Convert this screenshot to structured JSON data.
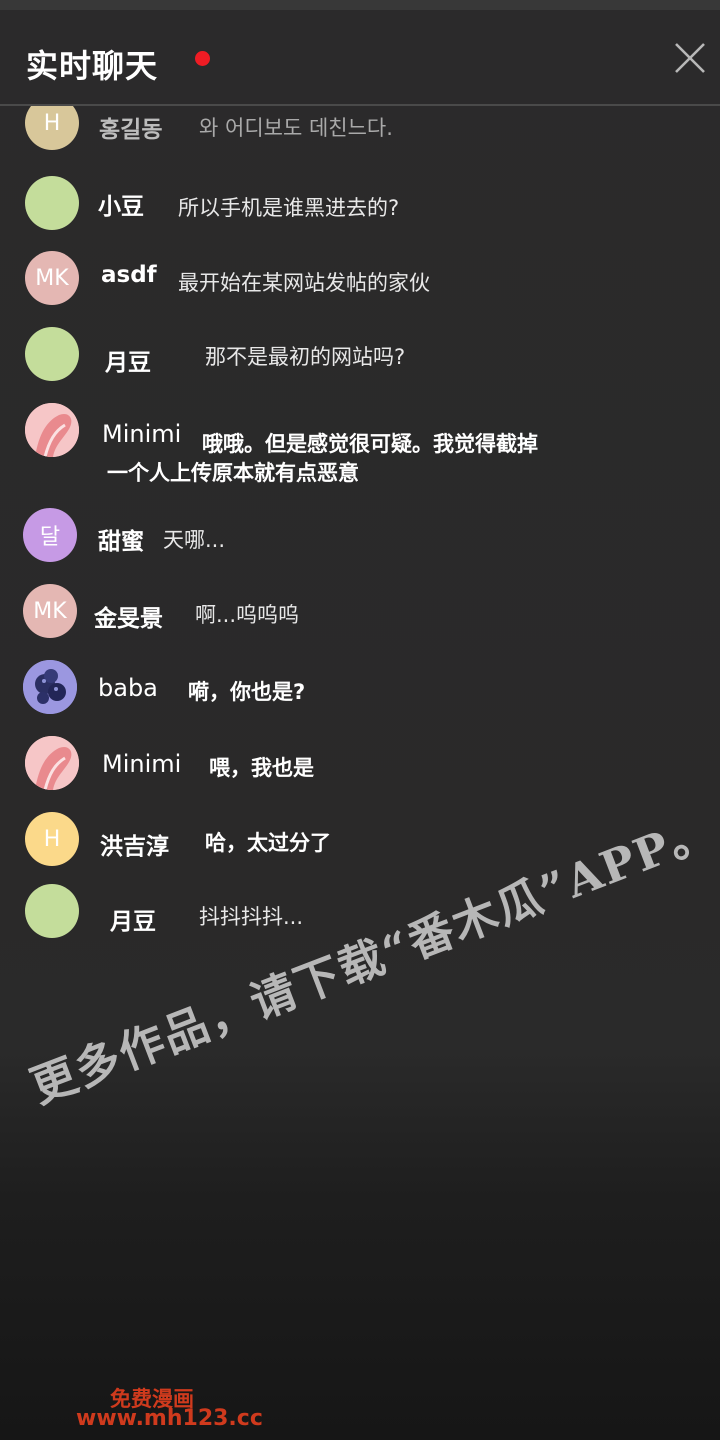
{
  "header": {
    "title": "实时聊天"
  },
  "messages": [
    {
      "name": "홍길동",
      "text": "와 어디보도 데친느다.",
      "avatar": "H",
      "avatar_color": "#d8c79a"
    },
    {
      "name": "小豆",
      "text": "所以手机是谁黑进去的?",
      "avatar": "",
      "avatar_color": "#c4dd9b"
    },
    {
      "name": "asdf",
      "text": "最开始在某网站发帖的家伙",
      "avatar": "MK",
      "avatar_color": "#e4b7b3"
    },
    {
      "name": "月豆",
      "text": "那不是最初的网站吗?",
      "avatar": "",
      "avatar_color": "#c4dd9b"
    },
    {
      "name": "Minimi",
      "text": "哦哦。但是感觉很可疑。我觉得截掉",
      "text2": "一个人上传原本就有点恶意",
      "avatar": "",
      "avatar_color": "#f3b1b4"
    },
    {
      "name": "甜蜜",
      "text": "天哪...",
      "avatar": "달",
      "avatar_color": "#c69ae5"
    },
    {
      "name": "金旻景",
      "text": "啊...呜呜呜",
      "avatar": "MK",
      "avatar_color": "#e4b7b3"
    },
    {
      "name": "baba",
      "text": "嗬，你也是?",
      "avatar": "",
      "avatar_color": "#8a86d8"
    },
    {
      "name": "Minimi",
      "text": "喂，我也是",
      "avatar": "",
      "avatar_color": "#f3b1b4"
    },
    {
      "name": "洪吉淳",
      "text": "哈，太过分了",
      "avatar": "H",
      "avatar_color": "#fbd98a"
    },
    {
      "name": "月豆",
      "text": "抖抖抖抖...",
      "avatar": "",
      "avatar_color": "#c4dd9b"
    }
  ],
  "watermark": "更多作品，请下载“番木瓜”APP。",
  "footer": {
    "line1": "免费漫画",
    "line2": "www.mh123.cc"
  }
}
